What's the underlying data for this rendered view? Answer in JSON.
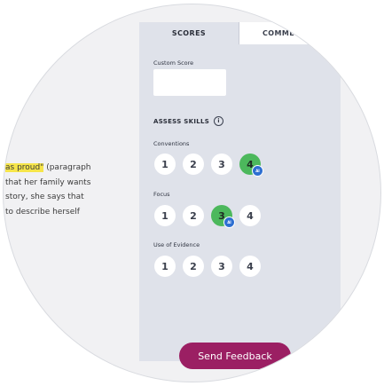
{
  "document": {
    "lines": [
      {
        "highlight": "as proud\"",
        "rest": " (paragraph"
      },
      {
        "highlight": "",
        "rest": "that her family wants"
      },
      {
        "highlight": "",
        "rest": "story, she says that"
      },
      {
        "highlight": "",
        "rest": "to describe herself"
      }
    ]
  },
  "tabs": [
    {
      "label": "SCORES",
      "active": true
    },
    {
      "label": "COMME",
      "active": false
    }
  ],
  "custom_score": {
    "label": "Custom Score",
    "value": ""
  },
  "assess": {
    "title": "ASSESS SKILLS",
    "info_icon": "i"
  },
  "skills": [
    {
      "name": "Conventions",
      "options": [
        "1",
        "2",
        "3",
        "4"
      ],
      "selected": "4",
      "badge": "AI"
    },
    {
      "name": "Focus",
      "options": [
        "1",
        "2",
        "3",
        "4"
      ],
      "selected": "3",
      "badge": "AI"
    },
    {
      "name": "Use of Evidence",
      "options": [
        "1",
        "2",
        "3",
        "4"
      ],
      "selected": null,
      "badge": ""
    }
  ],
  "send_button": "Send Feedback",
  "colors": {
    "panel": "#dfe2ea",
    "selected": "#4cb85c",
    "badge": "#2e6fd1",
    "send": "#9b1f63",
    "highlight": "#f6e54a"
  }
}
